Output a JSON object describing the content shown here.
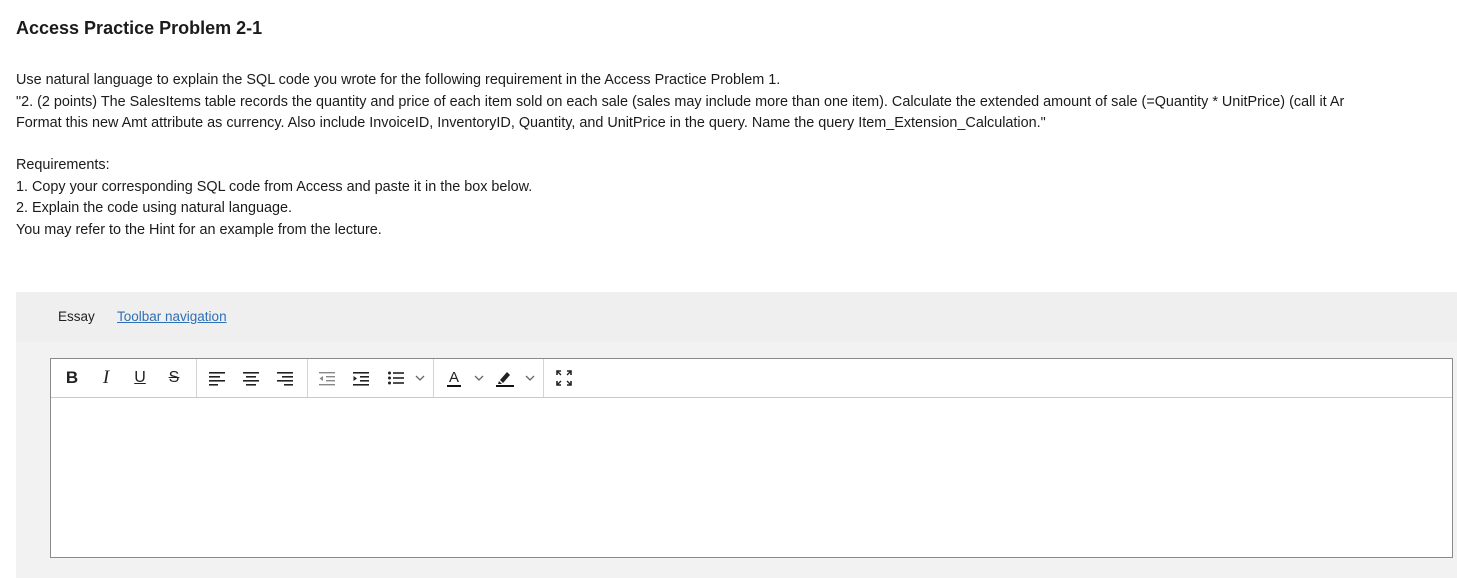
{
  "page": {
    "title": "Access Practice Problem 2-1",
    "intro_lines": [
      "Use natural language to explain the SQL code you wrote for the following requirement in the Access Practice Problem 1.",
      "\"2. (2 points) The SalesItems table records the quantity and price of each item sold on each sale (sales may include more than one item). Calculate the extended amount of sale (=Quantity * UnitPrice) (call it Ar",
      "Format this new Amt attribute as currency. Also include InvoiceID, InventoryID, Quantity, and UnitPrice in the query. Name the query Item_Extension_Calculation.\""
    ],
    "requirements_lines": [
      "Requirements:",
      "1. Copy your corresponding SQL code from Access and paste it in the box below.",
      "2. Explain the code using natural language.",
      "You may refer to the Hint for an example from the lecture."
    ]
  },
  "essay": {
    "label": "Essay",
    "toolbar_nav_link": "Toolbar navigation"
  },
  "editor": {
    "content": "",
    "toolbar": {
      "bold": "B",
      "italic": "I",
      "underline": "U",
      "strikethrough": "S",
      "text_color": "A",
      "icons": [
        "bold-icon",
        "italic-icon",
        "underline-icon",
        "strikethrough-icon",
        "align-left-icon",
        "align-center-icon",
        "align-right-icon",
        "outdent-icon",
        "indent-icon",
        "bullet-list-icon",
        "chevron-down-icon",
        "text-color-icon",
        "chevron-down-icon",
        "highlight-icon",
        "chevron-down-icon",
        "fullscreen-icon"
      ]
    }
  },
  "colors": {
    "link": "#2f6fb6",
    "panel_bg": "#f2f2f2",
    "editor_border": "#8a8a8a"
  }
}
